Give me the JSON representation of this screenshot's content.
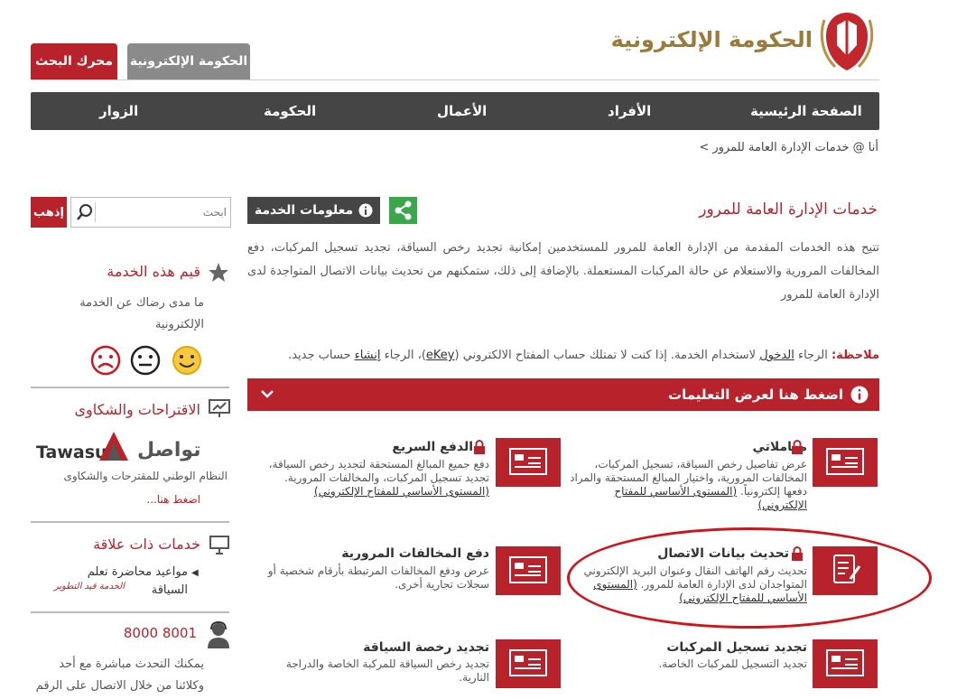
{
  "header": {
    "logo_text": "الحكومة الإلكترونية",
    "tab_search": "محرك البحث",
    "tab_gov": "الحكومة الإلكترونية"
  },
  "nav": {
    "home": "الصفحة الرئيسية",
    "individuals": "الأفراد",
    "business": "الأعمال",
    "government": "الحكومة",
    "visitors": "الزوار"
  },
  "breadcrumb": "أنا @ خدمات الإدارة العامة للمرور >",
  "sidebar": {
    "go_label": "إذهب",
    "search_placeholder": "ابحث",
    "rate_title": "قيم هذه الخدمة",
    "rate_text_1": "ما مدى رضاك عن الخدمة",
    "rate_text_2": "الإلكترونية",
    "suggestions_title": "الاقتراحات والشكاوى",
    "tawasul_en": "Tawasul",
    "tawasul_ar": "تواصل",
    "tawasul_sub": "النظام الوطني للمقترحات والشكاوى",
    "tawasul_link": "اضغط هنا...",
    "related_title": "خدمات ذات علاقة",
    "related_item_1": "مواعيد محاضرة تعلم",
    "related_item_2": "السياقة",
    "related_item_note": "الخدمة قيد التطوير",
    "phone": "8000 8001",
    "phone_text_1": "يمكنك التحدث مباشرة مع أحد",
    "phone_text_2": "وكلائنا من خلال الاتصال على الرقم"
  },
  "main": {
    "title": "خدمات الإدارة العامة للمرور",
    "info_label": "معلومات الخدمة",
    "intro": "تتيح هذه الخدمات المقدمة من الإدارة العامة للمرور للمستخدمين إمكانية تجديد رخص السياقة، تجديد تسجيل المركبات، دفع المخالفات المرورية والاستعلام عن حالة المركبات المستعملة. بالإضافة إلى ذلك، ستمكنهم من تحديث بيانات الاتصال المتواجدة لدى الإدارة العامة للمرور",
    "note_label": "ملاحظة:",
    "note_p1": " الرجاء ",
    "note_login": "الدخول",
    "note_p2": " لاستخدام الخدمة. إذا كنت لا تمتلك حساب المفتاح الالكتروني (",
    "note_ekey": "eKey",
    "note_p3": ")، الرجاء ",
    "note_create": "إنشاء",
    "note_p4": " حساب جديد.",
    "instructions": "اضغط هنا لعرض التعليمات"
  },
  "services": [
    {
      "title": "معاملاتي",
      "desc": "عرض تفاصيل رخص السياقة، تسجيل المركبات، المخالفات المرورية، واختيار المبالغ المستحقة والمراد دفعها إلكترونياً.",
      "level": "(المستوى الأساسي للمفتاح الإلكتروني)"
    },
    {
      "title": "الدفع السريع",
      "desc": "دفع جميع المبالغ المستحقة لتجديد رخص السياقة، تجديد تسجيل المركبات، والمخالفات المرورية.",
      "level": "(المستوى الأساسي للمفتاح الإلكتروني)"
    },
    {
      "title": "تحديث بيانات الاتصال",
      "desc": "تحديث رقم الهاتف النقال وعنوان البريد الإلكتروني المتواجدان لدى الإدارة العامة للمرور.",
      "level": "(المستوى الأساسي للمفتاح الإلكتروني)"
    },
    {
      "title": "دفع المخالفات المرورية",
      "desc": "عرض ودفع المخالفات المرتبطة بأرقام شخصية أو سجلات تجارية أخرى.",
      "level": ""
    },
    {
      "title": "تجديد تسجيل المركبات",
      "desc": "تجديد التسجيل للمركبات الخاصة.",
      "level": ""
    },
    {
      "title": "تجديد رخصة السياقة",
      "desc": "تجديد رخص السياقة للمركبة الخاصة والدراجة النارية.",
      "level": ""
    }
  ],
  "colors": {
    "brand_red": "#b8222b",
    "nav_dark": "#454545",
    "gold": "#9a7b3a",
    "share_green": "#3aa84a"
  }
}
